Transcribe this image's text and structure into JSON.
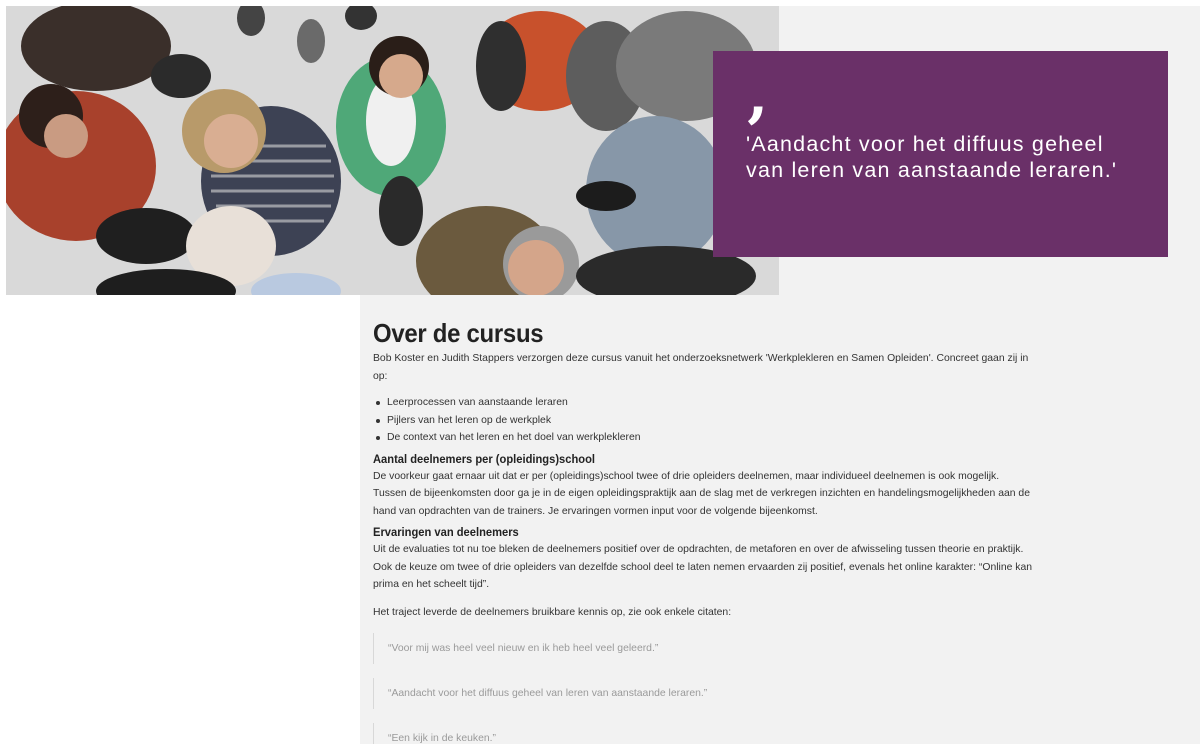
{
  "quote_box": {
    "mark": "‚",
    "text": "'Aandacht voor het diffuus geheel van leren van aanstaande leraren.'"
  },
  "article": {
    "title": "Over de cursus",
    "intro": "Bob Koster en Judith Stappers verzorgen deze cursus vanuit het onderzoeksnetwerk 'Werkplekleren en Samen Opleiden'. Concreet gaan zij in op:",
    "topics": [
      "Leerprocessen van aanstaande leraren",
      "Pijlers van het leren op de werkplek",
      "De context van het leren en het doel van werkplekleren"
    ],
    "section1": {
      "heading": "Aantal deelnemers per (opleidings)school",
      "body": "De voorkeur gaat ernaar uit dat er per (opleidings)school twee of drie opleiders deelnemen, maar individueel deelnemen is ook mogelijk. Tussen de bijeenkomsten door ga je in de eigen opleidingspraktijk aan de slag met de verkregen inzichten en handelingsmogelijkheden aan de hand van opdrachten van de trainers. Je ervaringen vormen input voor de volgende bijeenkomst."
    },
    "section2": {
      "heading": "Ervaringen van deelnemers",
      "body": "Uit de evaluaties tot nu toe bleken de deelnemers positief over de opdrachten, de metaforen en over de afwisseling tussen theorie en praktijk. Ook de keuze om twee of drie opleiders van dezelfde school deel te laten nemen ervaarden zij positief, evenals het online karakter: “Online kan prima en het scheelt tijd”.",
      "lead": "Het traject leverde de deelnemers bruikbare kennis op, zie ook enkele citaten:",
      "quotes": [
        "“Voor mij was heel veel nieuw en ik heb heel veel geleerd.”",
        "“Aandacht voor het diffuus geheel van leren van aanstaande leraren.”",
        "“Een kijk in de keuken.”"
      ]
    }
  },
  "colors": {
    "quote_box_bg": "#6a3068",
    "content_bg": "#f2f2f2",
    "text": "#333333",
    "quote_text": "#9a9a9a"
  },
  "icons": {
    "hero": "crowd-photo-image",
    "quote": "quote-mark-icon"
  }
}
